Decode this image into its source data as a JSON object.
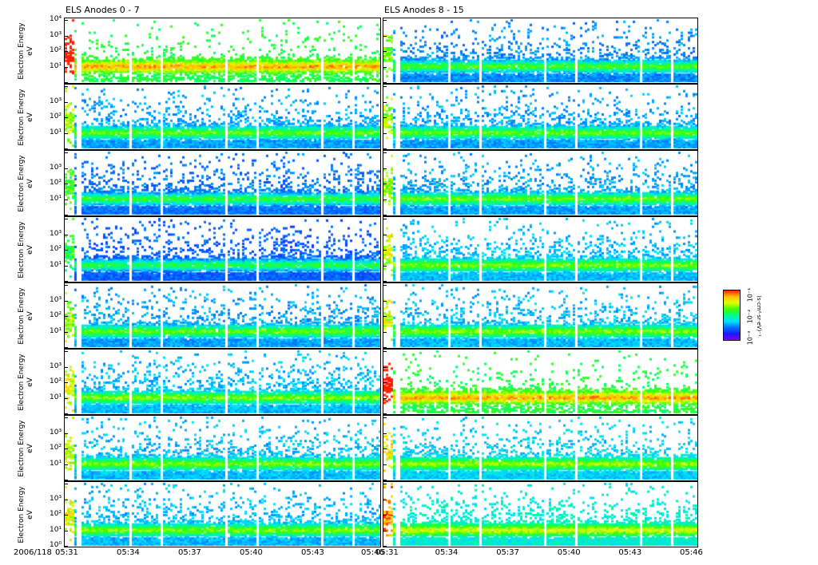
{
  "chart_data": {
    "type": "heatmap",
    "date_label": "2006/118",
    "ylabel": "Electron Energy",
    "yunit": "eV",
    "yscale": "log",
    "ylim": [
      1,
      10000
    ],
    "yticks": [
      "10⁰",
      "10¹",
      "10²",
      "10³",
      "10⁴"
    ],
    "xticks": [
      "05:31",
      "05:34",
      "05:37",
      "05:40",
      "05:43",
      "05:46"
    ],
    "columns": [
      {
        "title": "ELS Anodes 0 - 7",
        "anodes": [
          0,
          1,
          2,
          3,
          4,
          5,
          6,
          7
        ],
        "relative_level": [
          0.9,
          0.45,
          0.35,
          0.3,
          0.45,
          0.5,
          0.5,
          0.5
        ]
      },
      {
        "title": "ELS Anodes 8 - 15",
        "anodes": [
          8,
          9,
          10,
          11,
          12,
          13,
          14,
          15
        ],
        "relative_level": [
          0.4,
          0.45,
          0.45,
          0.5,
          0.5,
          0.9,
          0.55,
          0.65
        ]
      }
    ],
    "colorbar": {
      "ticks": [
        "10⁻¹",
        "10⁻²",
        "10⁻³"
      ],
      "label": "(s·cm²·sr·eV)⁻¹"
    },
    "band_center_eV": 10
  }
}
